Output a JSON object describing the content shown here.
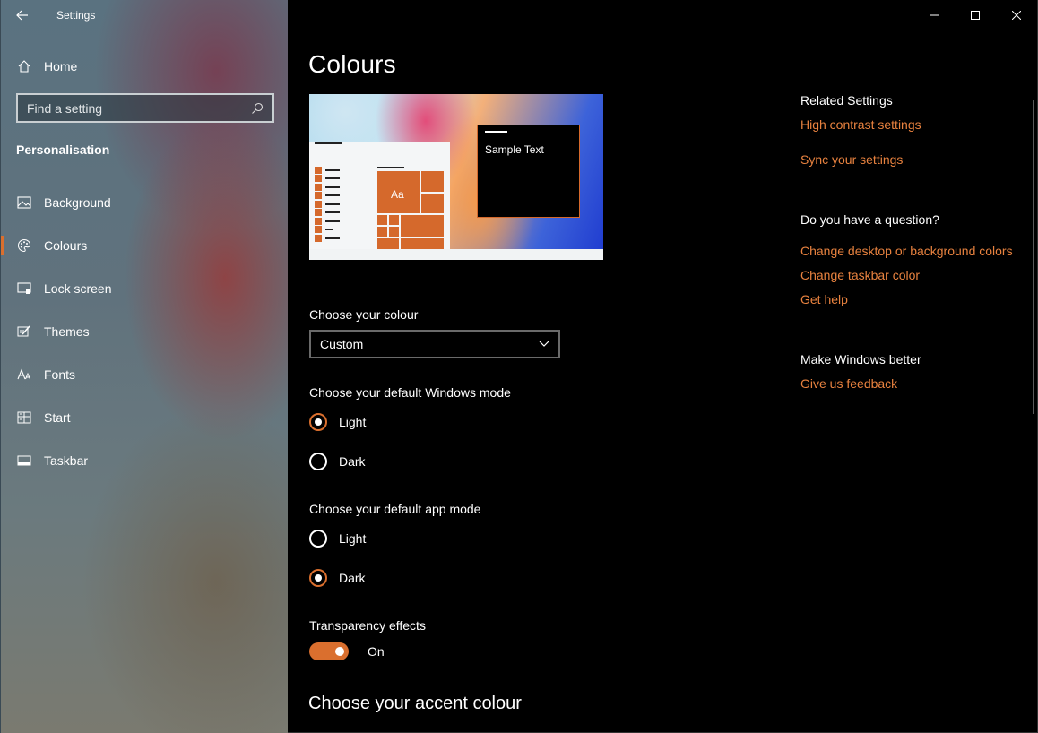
{
  "window": {
    "app_title": "Settings"
  },
  "sidebar": {
    "home_label": "Home",
    "search_placeholder": "Find a setting",
    "section_title": "Personalisation",
    "items": [
      {
        "label": "Background",
        "icon": "image-icon"
      },
      {
        "label": "Colours",
        "icon": "palette-icon",
        "selected": true
      },
      {
        "label": "Lock screen",
        "icon": "lock-screen-icon"
      },
      {
        "label": "Themes",
        "icon": "brush-icon"
      },
      {
        "label": "Fonts",
        "icon": "font-icon"
      },
      {
        "label": "Start",
        "icon": "start-icon"
      },
      {
        "label": "Taskbar",
        "icon": "taskbar-icon"
      }
    ]
  },
  "main": {
    "title": "Colours",
    "preview": {
      "tile_label": "Aa",
      "sample_text": "Sample Text"
    },
    "choose_colour": {
      "label": "Choose your colour",
      "value": "Custom"
    },
    "windows_mode": {
      "label": "Choose your default Windows mode",
      "options": [
        {
          "label": "Light",
          "checked": true
        },
        {
          "label": "Dark",
          "checked": false
        }
      ]
    },
    "app_mode": {
      "label": "Choose your default app mode",
      "options": [
        {
          "label": "Light",
          "checked": false
        },
        {
          "label": "Dark",
          "checked": true
        }
      ]
    },
    "transparency": {
      "label": "Transparency effects",
      "state": "On"
    },
    "accent_heading": "Choose your accent colour"
  },
  "related": {
    "heading": "Related Settings",
    "links": [
      "High contrast settings",
      "Sync your settings"
    ]
  },
  "question": {
    "heading": "Do you have a question?",
    "links": [
      "Change desktop or background colors",
      "Change taskbar color",
      "Get help"
    ]
  },
  "better": {
    "heading": "Make Windows better",
    "link": "Give us feedback"
  },
  "colors": {
    "accent": "#da6f2e",
    "link": "#e8823f"
  }
}
